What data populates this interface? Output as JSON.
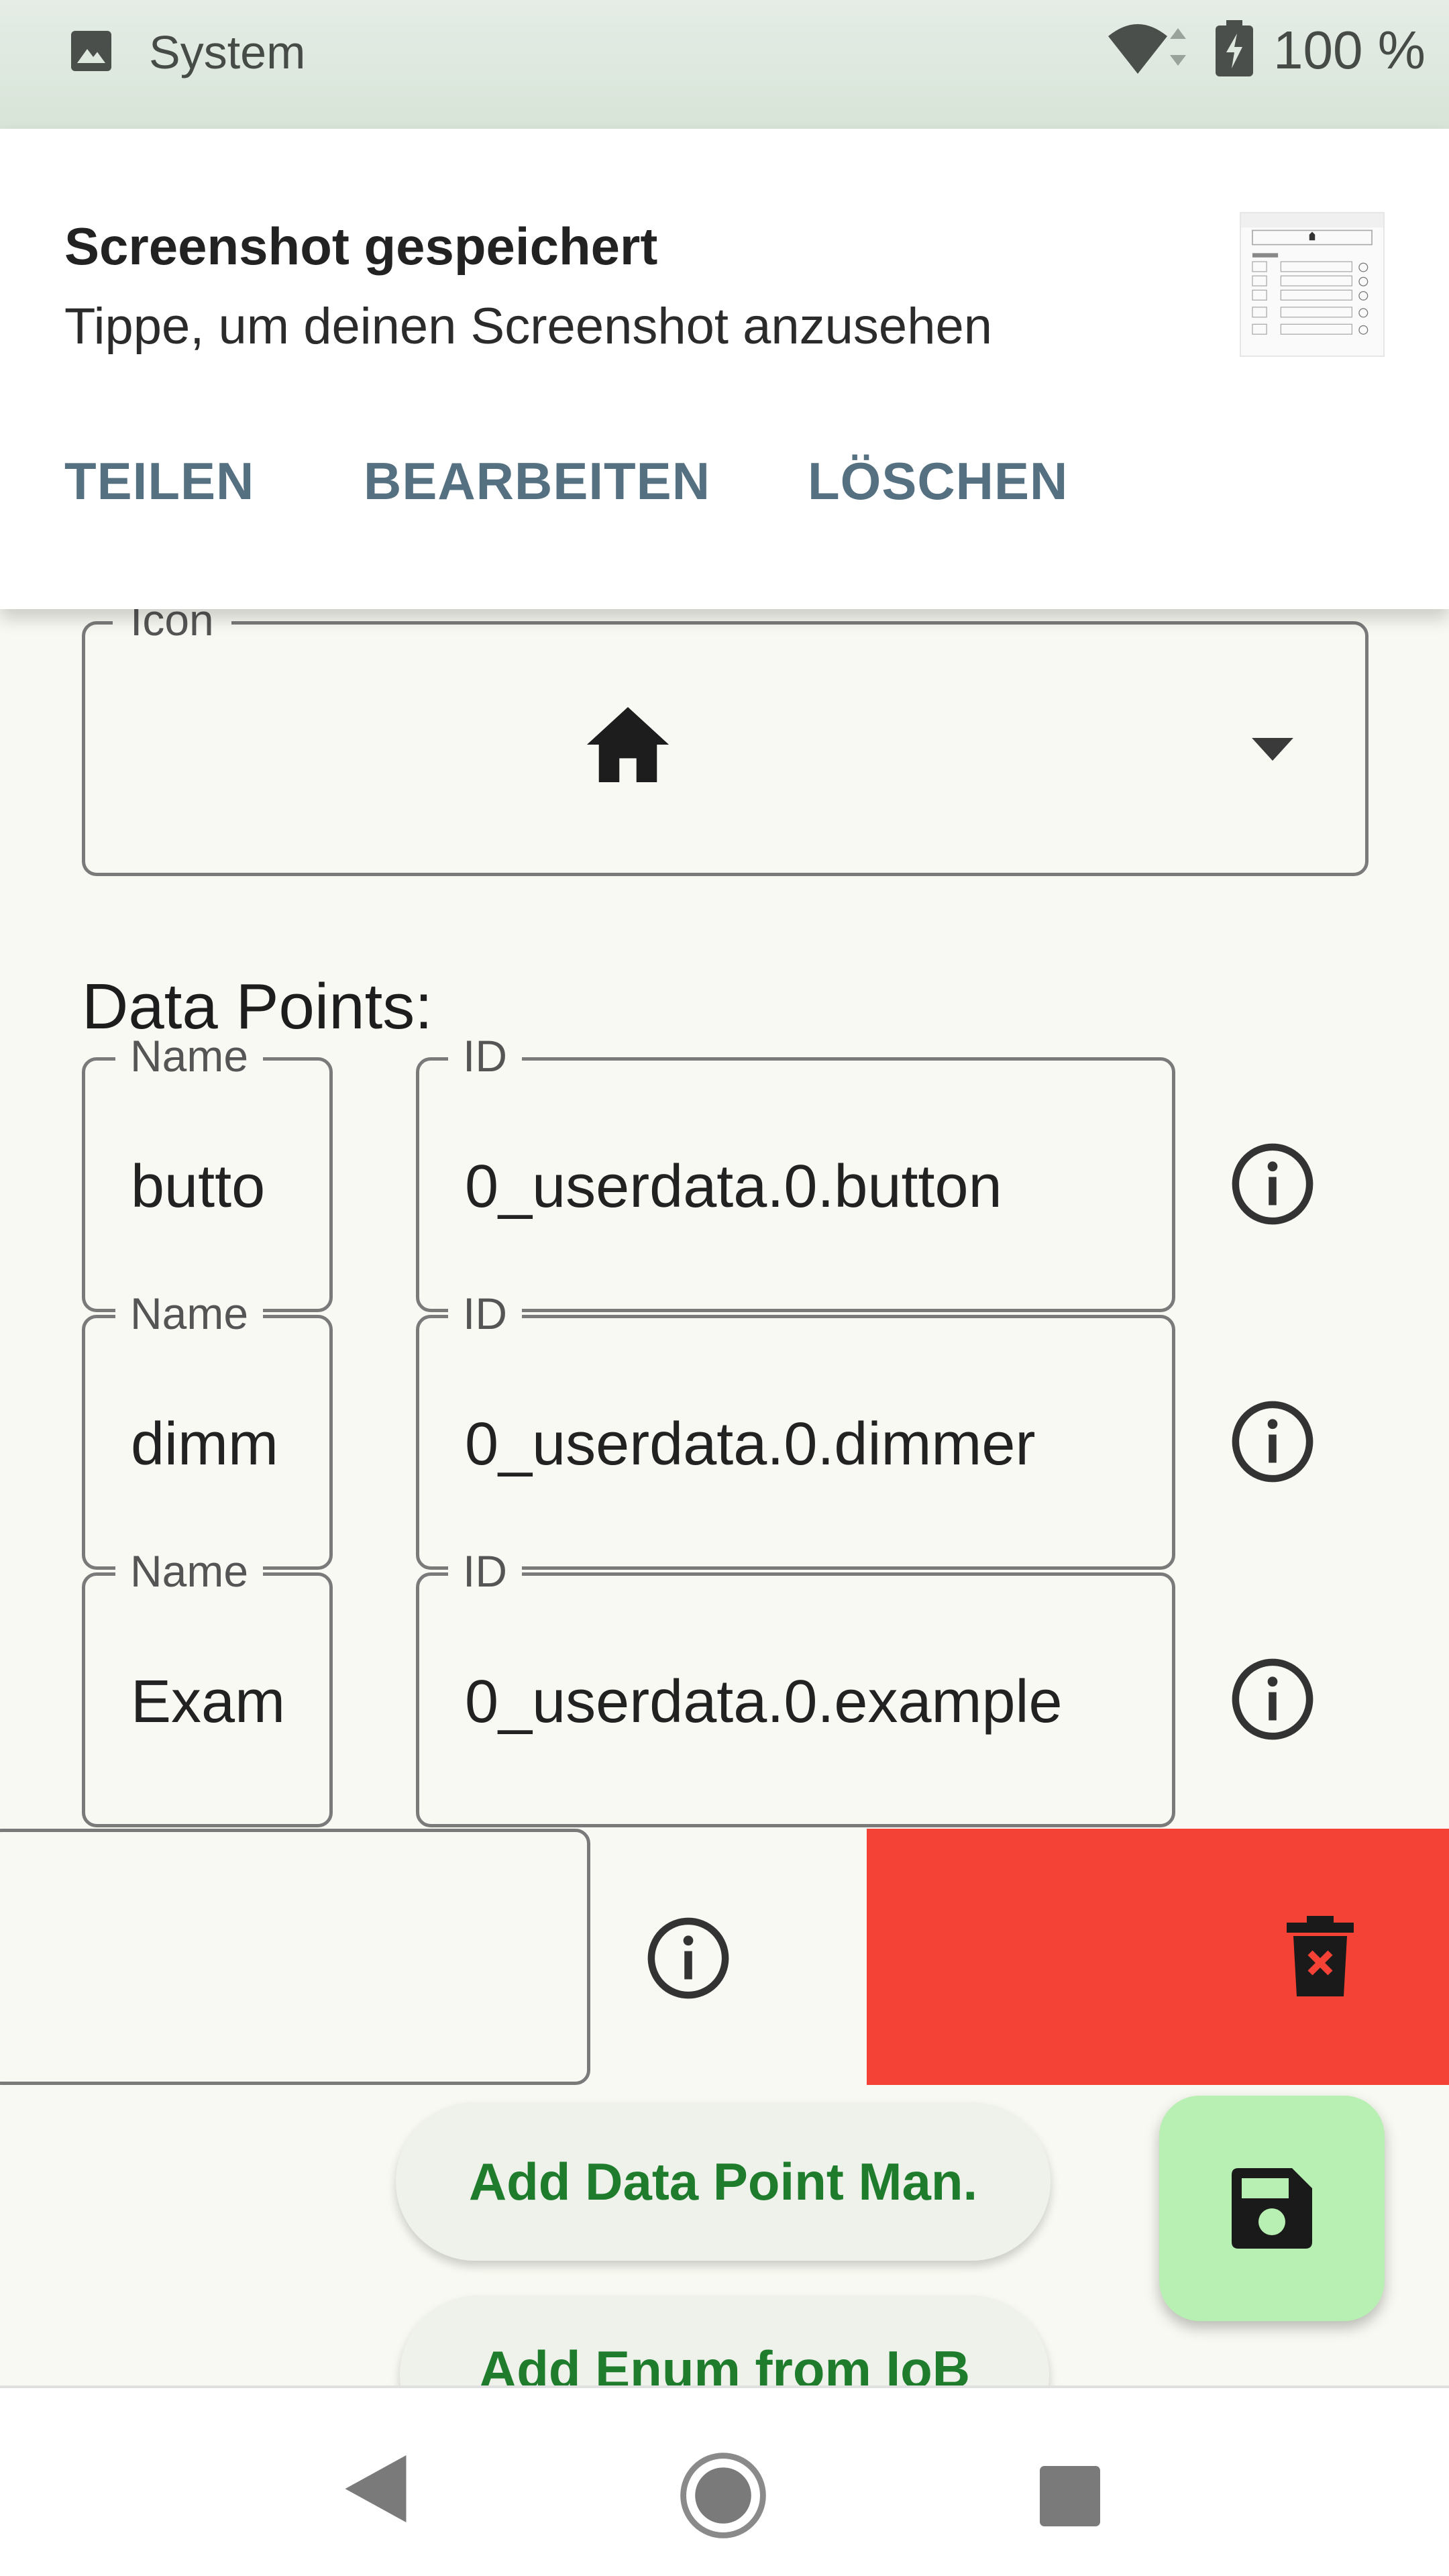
{
  "status_bar": {
    "app_label": "System",
    "icons": [
      "image-icon",
      "wifi-icon",
      "battery-charging-icon"
    ],
    "battery_text": "100 %"
  },
  "notification": {
    "title": "Screenshot gespeichert",
    "body": "Tippe, um deinen Screenshot anzusehen",
    "actions": [
      "TEILEN",
      "BEARBEITEN",
      "LÖSCHEN"
    ]
  },
  "icon_select": {
    "legend": "Icon",
    "selected_icon": "home-icon"
  },
  "data_points": {
    "heading": "Data Points:",
    "rows": [
      {
        "name_label": "Name",
        "name_value": "butto",
        "id_label": "ID",
        "id_value": "0_userdata.0.button"
      },
      {
        "name_label": "Name",
        "name_value": "dimm",
        "id_label": "ID",
        "id_value": "0_userdata.0.dimmer"
      },
      {
        "name_label": "Name",
        "name_value": "Exam",
        "id_label": "ID",
        "id_value": "0_userdata.0.example"
      }
    ]
  },
  "buttons": {
    "add_data_point": "Add Data Point Man.",
    "add_enum": "Add Enum from IoB"
  },
  "colors": {
    "delete_background": "#f44336",
    "fab_background": "#b8f0b4",
    "button_text": "#1e7c2c",
    "notification_action": "#557080"
  }
}
